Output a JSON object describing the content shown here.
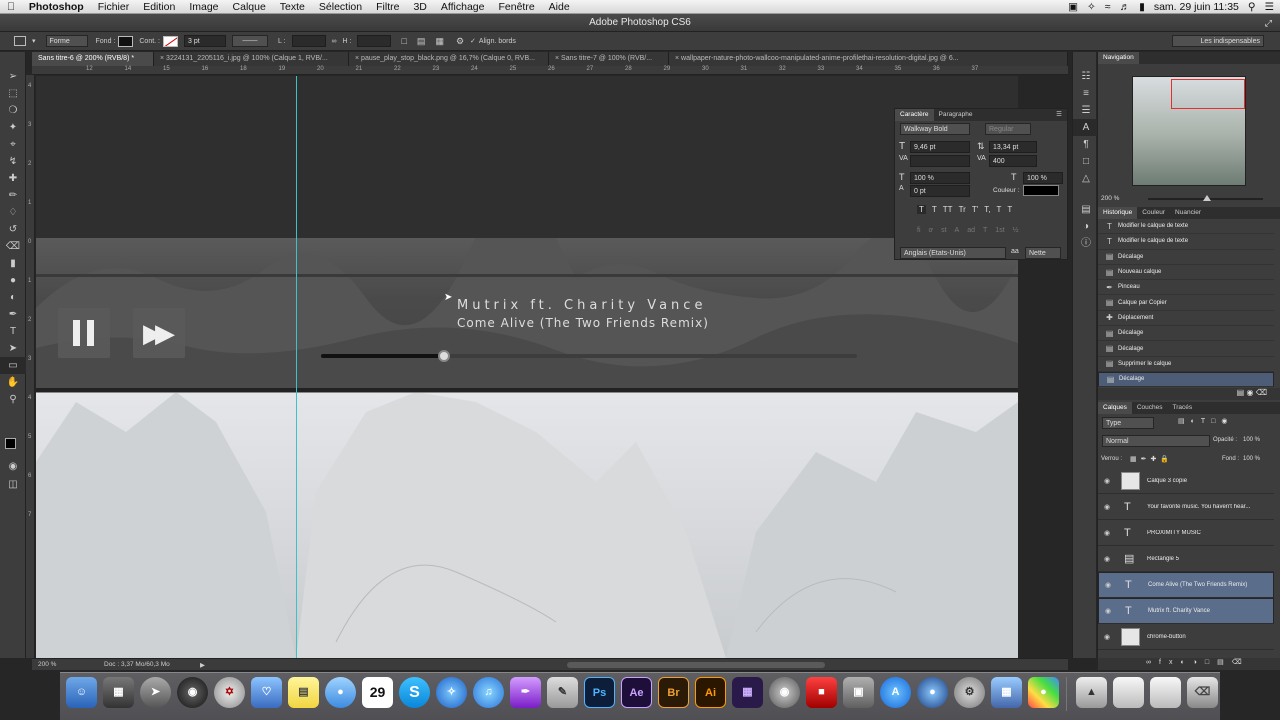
{
  "menubar": {
    "app": "Photoshop",
    "items": [
      "Fichier",
      "Edition",
      "Image",
      "Calque",
      "Texte",
      "Sélection",
      "Filtre",
      "3D",
      "Affichage",
      "Fenêtre",
      "Aide"
    ],
    "clock": "sam. 29 juin  11:35"
  },
  "window": {
    "title": "Adobe Photoshop CS6"
  },
  "options": {
    "shape_mode": "Forme",
    "fill_label": "Fond :",
    "stroke_label": "Cont. :",
    "stroke_width": "3 pt",
    "w_label": "L :",
    "h_label": "H :",
    "align_edges": "Align. bords",
    "workspace": "Les indispensables"
  },
  "tabs": [
    "Sans titre-6 @ 200% (RVB/8) *",
    "3224131_2205116_i.jpg @ 100% (Calque 1, RVB/...",
    "pause_play_stop_black.png @ 16,7% (Calque 0, RVB...",
    "Sans titre-7 @ 100% (RVB/...",
    "wallpaper-nature-photo-wallcoo-manipulated-anime-profilethai-resolution-digital.jpg @ 6..."
  ],
  "ruler": {
    "top": [
      "12",
      "14",
      "15",
      "16",
      "18",
      "19",
      "20",
      "21",
      "22",
      "23",
      "24",
      "25",
      "26",
      "27",
      "28",
      "29",
      "30",
      "31",
      "32",
      "33",
      "34",
      "35",
      "36",
      "37"
    ],
    "left": [
      "4",
      "3",
      "2",
      "1",
      "0",
      "1",
      "2",
      "3",
      "4",
      "5",
      "6",
      "7"
    ]
  },
  "canvas": {
    "track_artist": "Mutrix ft. Charity Vance",
    "track_title": "Come Alive (The Two Friends Remix)",
    "progress": 0.23
  },
  "character": {
    "tab_char": "Caractère",
    "tab_para": "Paragraphe",
    "font": "Walkway Bold",
    "style": "Regular",
    "size": "9,46 pt",
    "leading": "13,34 pt",
    "tracking": "400",
    "vscale": "100 %",
    "hscale": "100 %",
    "baseline": "0 pt",
    "color_label": "Couleur :",
    "language": "Anglais (Etats-Unis)",
    "aa": "Nette",
    "style_buttons": [
      "T",
      "T",
      "TT",
      "Tr",
      "T'",
      "T,",
      "T",
      "T"
    ],
    "feature_buttons": [
      "fi",
      "ơ",
      "st",
      "A",
      "ad",
      "T",
      "1st",
      "½"
    ]
  },
  "navigator": {
    "title": "Navigation",
    "zoom": "200 %"
  },
  "history": {
    "tabs": [
      "Historique",
      "Couleur",
      "Nuancier"
    ],
    "items": [
      {
        "icon": "text-icon",
        "label": "Modifier le calque de texte"
      },
      {
        "icon": "text-icon",
        "label": "Modifier le calque de texte"
      },
      {
        "icon": "step-icon",
        "label": "Décalage"
      },
      {
        "icon": "step-icon",
        "label": "Nouveau calque"
      },
      {
        "icon": "brush-icon",
        "label": "Pinceau"
      },
      {
        "icon": "step-icon",
        "label": "Calque par Copier"
      },
      {
        "icon": "move-icon",
        "label": "Déplacement"
      },
      {
        "icon": "step-icon",
        "label": "Décalage"
      },
      {
        "icon": "step-icon",
        "label": "Décalage"
      },
      {
        "icon": "step-icon",
        "label": "Supprimer le calque"
      },
      {
        "icon": "step-icon",
        "label": "Décalage"
      }
    ]
  },
  "layers": {
    "tabs": [
      "Calques",
      "Couches",
      "Tracés"
    ],
    "filter": "Type",
    "blend": "Normal",
    "opacity_label": "Opacité :",
    "opacity": "100 %",
    "lock_label": "Verrou :",
    "fill_label": "Fond :",
    "fill": "100 %",
    "items": [
      {
        "kind": "image",
        "name": "Calque 3 copie"
      },
      {
        "kind": "text",
        "name": "Your favorite music. You haven't hear..."
      },
      {
        "kind": "text",
        "name": "PROXIMITY MUSIC"
      },
      {
        "kind": "shape",
        "name": "Rectangle 5"
      },
      {
        "kind": "text",
        "name": "Come Alive (The Two Friends Remix)"
      },
      {
        "kind": "text",
        "name": "Mutrix ft. Charity Vance"
      },
      {
        "kind": "image",
        "name": "chrome-button"
      }
    ]
  },
  "status": {
    "zoom": "200 %",
    "doc": "Doc : 3,37 Mo/60,3 Mo"
  },
  "dock": {
    "calendar_day": "29",
    "ps": "Ps",
    "ae": "Ae",
    "br": "Br",
    "ai": "Ai"
  }
}
